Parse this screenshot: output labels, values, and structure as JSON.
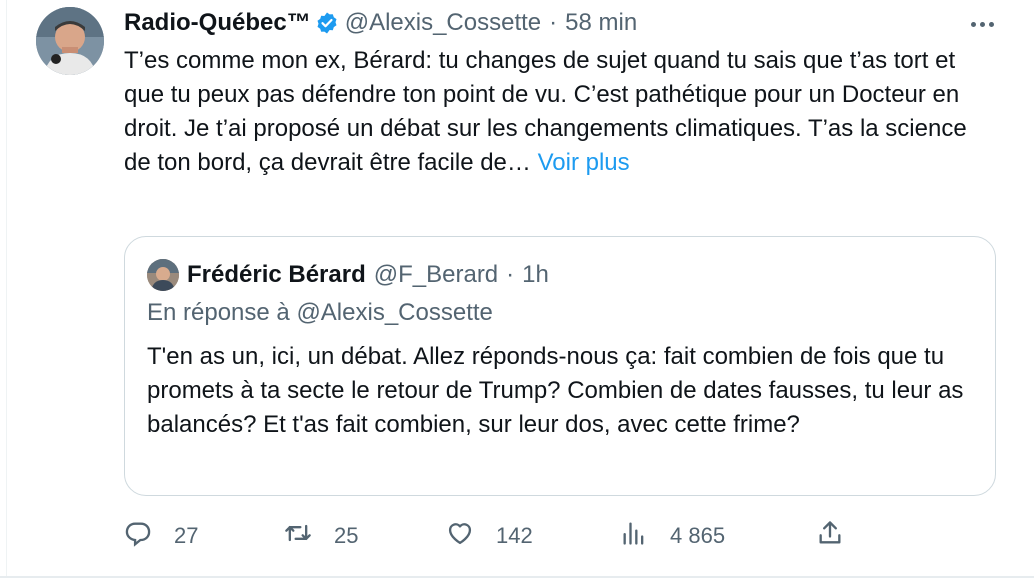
{
  "tweet": {
    "author_name": "Radio-Québec™",
    "handle": "@Alexis_Cossette",
    "separator": "·",
    "time": "58 min",
    "text": "T’es comme mon ex, Bérard: tu changes de sujet quand tu sais que t’as tort et que tu peux pas défendre ton point de vu. C’est pathétique pour un Docteur en droit. Je t’ai proposé un débat sur les changements climatiques. T’as la science de ton bord, ça devrait être facile de… ",
    "more_link": "Voir plus",
    "icons": {
      "verified": "verified-badge-icon",
      "more": "more-options-icon"
    }
  },
  "quote": {
    "author_name": "Frédéric Bérard",
    "handle": "@F_Berard",
    "separator": "·",
    "time": "1h",
    "reply_to": "En réponse à @Alexis_Cossette",
    "text": "T'en as un, ici, un débat. Allez réponds-nous ça: fait combien de fois que tu promets à ta secte le retour de Trump? Combien de dates fausses, tu leur as balancés? Et t'as fait combien, sur leur dos, avec cette frime?"
  },
  "actions": {
    "replies": "27",
    "retweets": "25",
    "likes": "142",
    "views": "4 865",
    "icons": [
      "reply-icon",
      "retweet-icon",
      "like-icon",
      "views-icon",
      "share-icon"
    ]
  },
  "colors": {
    "text": "#0f1419",
    "secondary": "#536471",
    "accent": "#1d9bf0",
    "border": "#cfd9de"
  }
}
